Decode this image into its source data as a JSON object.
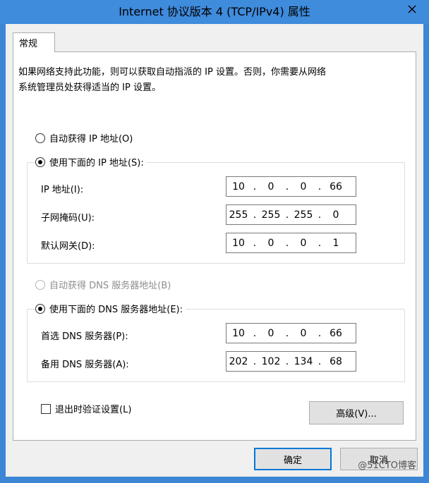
{
  "window": {
    "title": "Internet 协议版本 4 (TCP/IPv4) 属性"
  },
  "tabs": [
    {
      "label": "常规"
    }
  ],
  "description": {
    "line1": "如果网络支持此功能，则可以获取自动指派的 IP 设置。否则，你需要从网络",
    "line2": "系统管理员处获得适当的 IP 设置。"
  },
  "ip": {
    "auto_label": "自动获得 IP 地址(O)",
    "manual_label": "使用下面的 IP 地址(S):",
    "address_label": "IP 地址(I):",
    "address": [
      "10",
      "0",
      "0",
      "66"
    ],
    "subnet_label": "子网掩码(U):",
    "subnet": [
      "255",
      "255",
      "255",
      "0"
    ],
    "gateway_label": "默认网关(D):",
    "gateway": [
      "10",
      "0",
      "0",
      "1"
    ]
  },
  "dns": {
    "auto_label": "自动获得 DNS 服务器地址(B)",
    "manual_label": "使用下面的 DNS 服务器地址(E):",
    "preferred_label": "首选 DNS 服务器(P):",
    "preferred": [
      "10",
      "0",
      "0",
      "66"
    ],
    "alternate_label": "备用 DNS 服务器(A):",
    "alternate": [
      "202",
      "102",
      "134",
      "68"
    ]
  },
  "validate_label": "退出时验证设置(L)",
  "advanced_label": "高级(V)...",
  "ok_label": "确定",
  "cancel_label": "取消",
  "watermark": "@51CTO博客",
  "colors": {
    "titlebar": "#3f8bdc",
    "accent": "#0078d7"
  },
  "icons": {
    "close": "close-icon"
  }
}
